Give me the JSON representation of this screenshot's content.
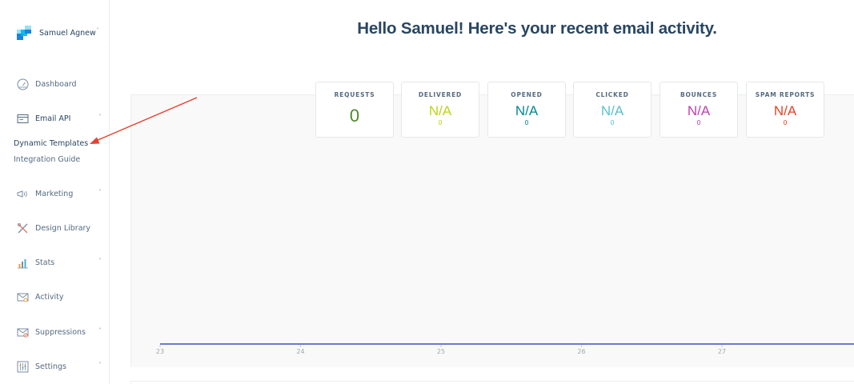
{
  "account": {
    "name": "Samuel Agnew",
    "icon": "sendgrid-logo-icon",
    "chevron": "˅"
  },
  "sidebar": {
    "items": [
      {
        "label": "Dashboard",
        "icon": "gauge-icon"
      },
      {
        "label": "Email API",
        "icon": "email-api-icon",
        "chevron": "˅"
      },
      {
        "label": "Marketing",
        "icon": "megaphone-icon",
        "chevron": "˅"
      },
      {
        "label": "Design Library",
        "icon": "design-tools-icon"
      },
      {
        "label": "Stats",
        "icon": "bar-chart-icon",
        "chevron": "˅"
      },
      {
        "label": "Activity",
        "icon": "envelope-search-icon"
      },
      {
        "label": "Suppressions",
        "icon": "envelope-block-icon",
        "chevron": "˅"
      },
      {
        "label": "Settings",
        "icon": "sliders-icon",
        "chevron": "˅"
      }
    ],
    "email_api_subitems": [
      "Dynamic Templates",
      "Integration Guide"
    ]
  },
  "main": {
    "greeting": "Hello Samuel! Here's your recent email activity."
  },
  "stats": [
    {
      "title": "REQUESTS",
      "value": "0",
      "sub": "",
      "color": "#4b8a2a"
    },
    {
      "title": "DELIVERED",
      "value": "N/A",
      "sub": "0",
      "color": "#bcd514"
    },
    {
      "title": "OPENED",
      "value": "N/A",
      "sub": "0",
      "color": "#028690"
    },
    {
      "title": "CLICKED",
      "value": "N/A",
      "sub": "0",
      "color": "#59c1ca"
    },
    {
      "title": "BOUNCES",
      "value": "N/A",
      "sub": "0",
      "color": "#c041ad"
    },
    {
      "title": "SPAM REPORTS",
      "value": "N/A",
      "sub": "0",
      "color": "#e04427"
    }
  ],
  "chart_data": {
    "type": "line",
    "categories": [
      "23",
      "24",
      "25",
      "26",
      "27"
    ],
    "series": [
      {
        "values": [
          0,
          0,
          0,
          0,
          0
        ],
        "color": "#3d4fbf"
      }
    ]
  },
  "colors": {
    "annotation_arrow": "#e8402e",
    "heading": "#294661"
  }
}
